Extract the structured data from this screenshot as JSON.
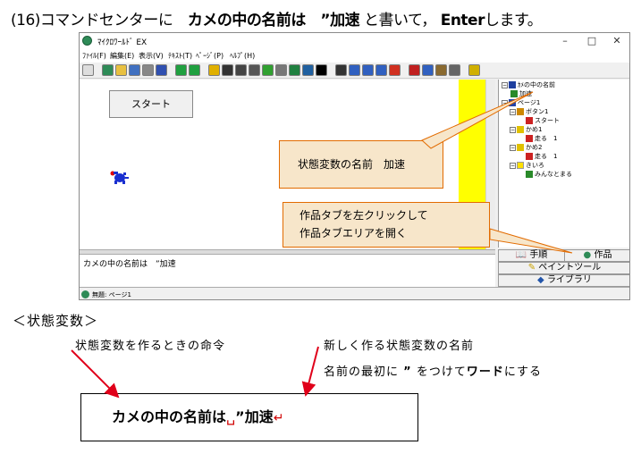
{
  "heading": {
    "step": "(16)",
    "text1": "コマンドセンターに　",
    "code": "カメの中の名前は　”加速",
    "text2": "と書いて，",
    "enter": "Enter",
    "text3": "します。"
  },
  "window": {
    "title": "ﾏｲｸﾛﾜｰﾙﾄﾞ EX",
    "controls": {
      "minimize": "–",
      "maximize": "□",
      "close": "✕"
    },
    "menu": [
      "ﾌｧｲﾙ(F)",
      "編集(E)",
      "表示(V)",
      "ﾃｷｽﾄ(T)",
      "ﾍﾟｰｼﾞ(P)",
      "ﾍﾙﾌﾟ(H)"
    ],
    "toolbar_icons": [
      "page-icon",
      "turtle-icon",
      "open-icon",
      "save-icon",
      "print-icon",
      "card-icon",
      "back-icon",
      "forward-icon",
      "turtle-new-icon",
      "text-icon",
      "paint-icon",
      "eye-icon",
      "music-icon",
      "pen-icon",
      "shape-icon",
      "world-icon",
      "pointer-icon",
      "eye2-icon",
      "stamp-icon",
      "zoom-in-icon",
      "zoom-out-icon",
      "stop-icon",
      "scissors-icon",
      "copy-icon",
      "paste-icon",
      "undo-icon",
      "help-icon"
    ],
    "start_button": "スタート",
    "command_text": "カメの中の名前は　”加速",
    "status_text": "無題: ページ1",
    "tree": [
      {
        "box": "−",
        "label": "ｶﾒの中の名前",
        "icon": "#1f3f9f"
      },
      {
        "box": "",
        "label": "加速",
        "icon": "#2a8a2a"
      },
      {
        "box": "−",
        "label": "ページ1",
        "icon": "#2244aa"
      },
      {
        "box": "−",
        "label": "ボタン1",
        "icon": "#cc8800"
      },
      {
        "box": "",
        "label": "スタート",
        "icon": "#cc2222"
      },
      {
        "box": "−",
        "label": "かめ1",
        "icon": "#e0c000"
      },
      {
        "box": "",
        "label": "走る　1",
        "icon": "#cc2222"
      },
      {
        "box": "−",
        "label": "かめ2",
        "icon": "#e0c000"
      },
      {
        "box": "",
        "label": "走る　1",
        "icon": "#cc2222"
      },
      {
        "box": "−",
        "label": "きいろ",
        "icon": "#ffe000"
      },
      {
        "box": "",
        "label": "みんなとまる",
        "icon": "#2a8a2a"
      }
    ],
    "tabs": {
      "procedure": "手順",
      "works": "作品",
      "paint": "ペイントツール",
      "library": "ライブラリ"
    }
  },
  "callouts": {
    "state_var": "状態変数の名前　加速",
    "tab_line1": "作品タブを左クリックして",
    "tab_line2": "作品タブエリアを開く"
  },
  "section": {
    "title": "＜状態変数＞",
    "note_command": "状態変数を作るときの命令",
    "note_name": "新しく作る状態変数の名前",
    "note_prefix_1": "名前の最初に",
    "note_quote": "”",
    "note_prefix_2": "をつけて",
    "note_word": "ワード",
    "note_prefix_3": "にする"
  },
  "example": {
    "cmd": "カメの中の名前は",
    "space_mark": "␣",
    "name": "”加速",
    "return_mark": "↵"
  },
  "colors": {
    "callout_fill": "#f7e6ca",
    "callout_border": "#e26b00",
    "arrow": "#e0001a",
    "stage_stripe": "#ffff00"
  }
}
